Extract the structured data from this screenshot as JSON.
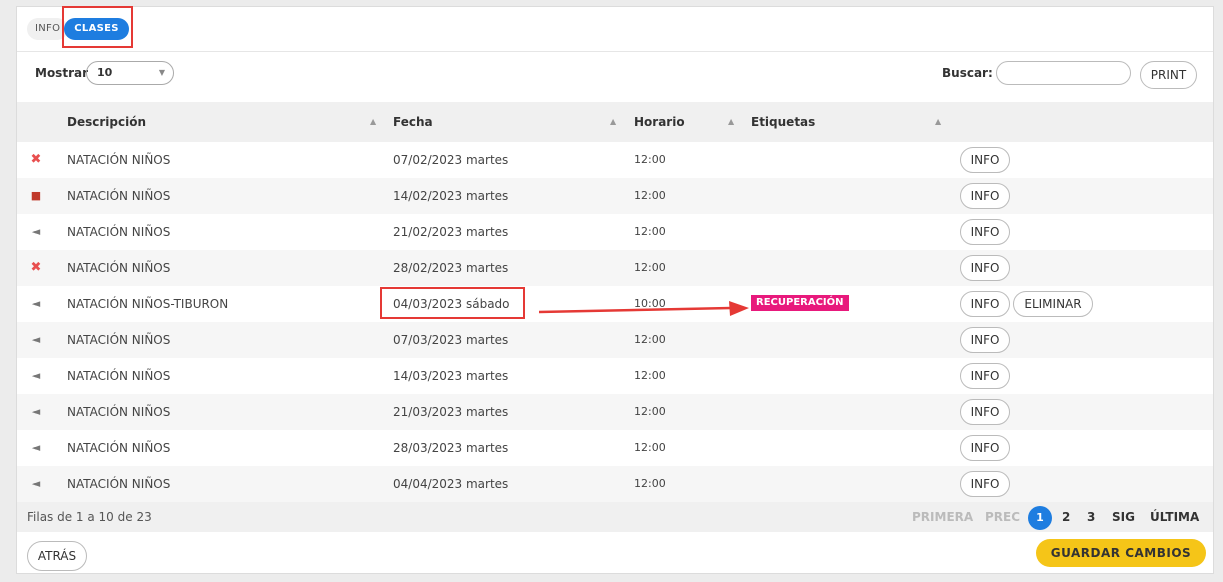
{
  "tabs": {
    "info": "INFO",
    "clases": "CLASES"
  },
  "controls": {
    "mostrar_label": "Mostrar",
    "page_size": "10",
    "buscar_label": "Buscar:",
    "search_value": "",
    "print_label": "PRINT"
  },
  "table": {
    "columns": [
      "Descripción",
      "Fecha",
      "Horario",
      "Etiquetas"
    ],
    "info_button": "INFO",
    "eliminar_button": "ELIMINAR",
    "rows": [
      {
        "icon": "x-icon",
        "desc": "NATACIÓN NIÑOS",
        "fecha": "07/02/2023 martes",
        "horario": "12:00",
        "etiqueta": ""
      },
      {
        "icon": "bag-icon",
        "desc": "NATACIÓN NIÑOS",
        "fecha": "14/02/2023 martes",
        "horario": "12:00",
        "etiqueta": ""
      },
      {
        "icon": "swim-icon",
        "desc": "NATACIÓN NIÑOS",
        "fecha": "21/02/2023 martes",
        "horario": "12:00",
        "etiqueta": ""
      },
      {
        "icon": "x-icon",
        "desc": "NATACIÓN NIÑOS",
        "fecha": "28/02/2023 martes",
        "horario": "12:00",
        "etiqueta": ""
      },
      {
        "icon": "swim-icon",
        "desc": "NATACIÓN NIÑOS-TIBURON",
        "fecha": "04/03/2023 sábado",
        "horario": "10:00",
        "etiqueta": "RECUPERACIÓN"
      },
      {
        "icon": "swim-icon",
        "desc": "NATACIÓN NIÑOS",
        "fecha": "07/03/2023 martes",
        "horario": "12:00",
        "etiqueta": ""
      },
      {
        "icon": "swim-icon",
        "desc": "NATACIÓN NIÑOS",
        "fecha": "14/03/2023 martes",
        "horario": "12:00",
        "etiqueta": ""
      },
      {
        "icon": "swim-icon",
        "desc": "NATACIÓN NIÑOS",
        "fecha": "21/03/2023 martes",
        "horario": "12:00",
        "etiqueta": ""
      },
      {
        "icon": "swim-icon",
        "desc": "NATACIÓN NIÑOS",
        "fecha": "28/03/2023 martes",
        "horario": "12:00",
        "etiqueta": ""
      },
      {
        "icon": "swim-icon",
        "desc": "NATACIÓN NIÑOS",
        "fecha": "04/04/2023 martes",
        "horario": "12:00",
        "etiqueta": ""
      }
    ]
  },
  "footer": {
    "filas": "Filas de 1 a 10 de 23",
    "primera": "PRIMERA",
    "prec": "PREC",
    "page1": "1",
    "page2": "2",
    "page3": "3",
    "sig": "SIG",
    "ultima": "ÚLTIMA"
  },
  "actions": {
    "atras": "ATRÁS",
    "guardar": "GUARDAR CAMBIOS"
  },
  "colors": {
    "accent": "#1e7de0",
    "badge": "#e8197c",
    "save": "#f5c518",
    "highlight": "#e53935"
  }
}
